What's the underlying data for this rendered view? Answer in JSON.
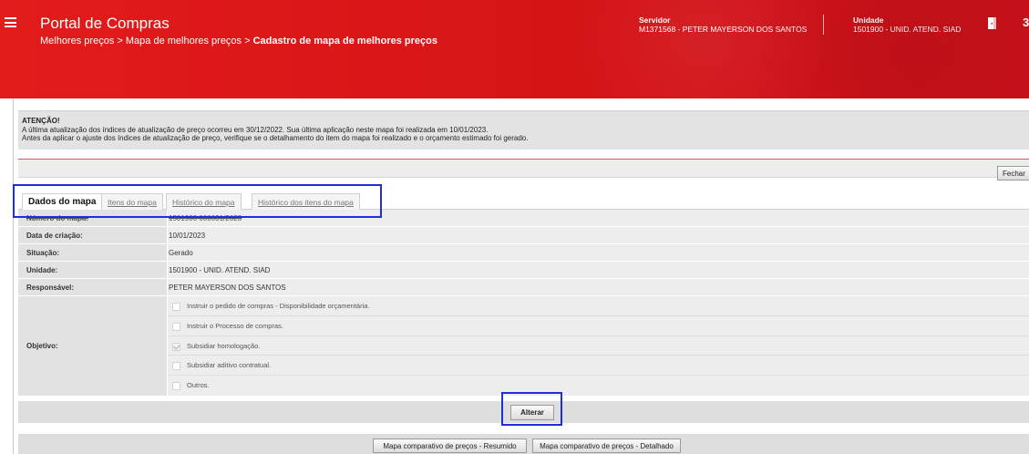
{
  "header": {
    "app_title": "Portal de Compras",
    "breadcrumb_1": "Melhores preços",
    "breadcrumb_sep": " > ",
    "breadcrumb_2": "Mapa de melhores preços",
    "breadcrumb_3": "Cadastro de mapa de melhores preços",
    "servidor_label": "Servidor",
    "servidor_value": "M1371568 - PETER MAYERSON DOS SANTOS",
    "unidade_label": "Unidade",
    "unidade_value": "1501900 - UNID. ATEND. SIAD",
    "exit_glyph": "3"
  },
  "notice": {
    "title": "ATENÇÃO!",
    "line1": "A última atualização dos índices de atualização de preço ocorreu em 30/12/2022. Sua última aplicação neste mapa foi realizada em 10/01/2023.",
    "line2": "Antes da aplicar o ajuste dos índices de atualização de preço, verifique se o detalhamento do item do mapa foi realizado e o orçamento estimado foi gerado."
  },
  "toolbar": {
    "fechar_label": "Fechar"
  },
  "tabs": [
    {
      "label": "Dados do mapa",
      "active": true
    },
    {
      "label": "Itens do mapa",
      "active": false
    },
    {
      "label": "Histórico do mapa",
      "active": false
    },
    {
      "label": "Histórico dos itens do mapa",
      "active": false
    }
  ],
  "form": {
    "numero_label": "Número do mapa:",
    "numero_value": "1501900 000031/2023",
    "data_label": "Data de criação:",
    "data_value": "10/01/2023",
    "situacao_label": "Situação:",
    "situacao_value": "Gerado",
    "unidade_label": "Unidade:",
    "unidade_value": "1501900 - UNID. ATEND. SIAD",
    "responsavel_label": "Responsável:",
    "responsavel_value": "PETER MAYERSON DOS SANTOS",
    "objetivo_label": "Objetivo:",
    "objetivo_options": [
      {
        "label": "Instruir o pedido de compras - Disponibilidade orçamentária.",
        "checked": false
      },
      {
        "label": "Instruir o Processo de compras.",
        "checked": false
      },
      {
        "label": "Subsidiar homologação.",
        "checked": true
      },
      {
        "label": "Subsidiar aditivo contratual.",
        "checked": false
      },
      {
        "label": "Outros.",
        "checked": false
      }
    ]
  },
  "actions": {
    "alterar_label": "Alterar"
  },
  "footer": {
    "resumido_label": "Mapa comparativo de preços - Resumido",
    "detalhado_label": "Mapa comparativo de preços - Detalhado"
  },
  "colors": {
    "header_red": "#d61417",
    "highlight_blue": "#1c2fd8"
  },
  "icons": {
    "menu": "hamburger-icon",
    "exit": "door-icon"
  }
}
